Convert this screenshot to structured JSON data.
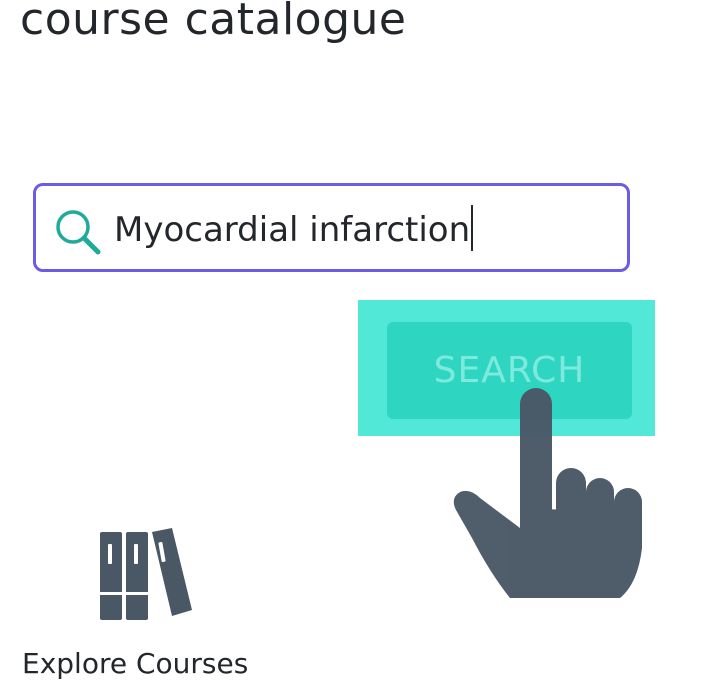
{
  "header": {
    "title": "course catalogue"
  },
  "search": {
    "value": "Myocardial infarction",
    "icon": "search-icon",
    "button_label": "SEARCH"
  },
  "cursor": {
    "icon": "pointing-hand-icon"
  },
  "explore": {
    "icon": "books-icon",
    "label": "Explore Courses"
  },
  "colors": {
    "accent_border": "#6b5be6",
    "button_bg": "#2ed6c2",
    "highlight_bg": "#52e8d8",
    "icon_teal": "#1faa9b",
    "icon_slate": "#4a5866"
  }
}
